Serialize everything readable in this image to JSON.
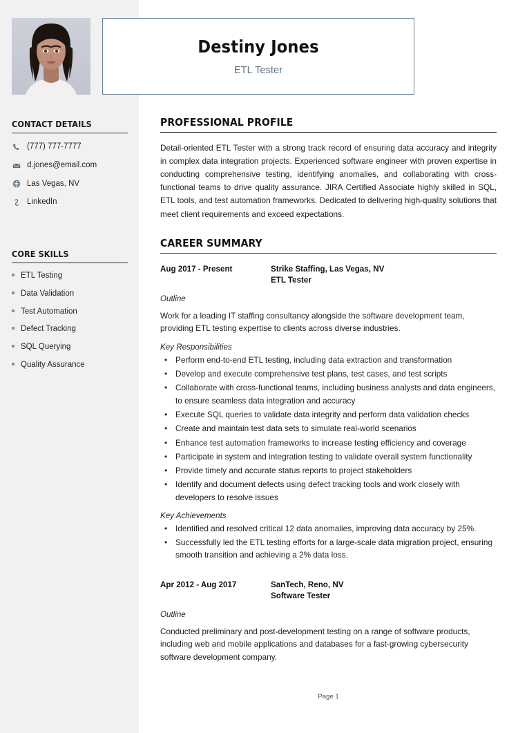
{
  "header": {
    "name": "Destiny Jones",
    "title": "ETL Tester",
    "photo_alt": "candidate-photo",
    "border_color": "#6b7f94",
    "title_color": "#5c7185"
  },
  "sidebar": {
    "background": "#f1f1f1",
    "contact": {
      "heading": "CONTACT DETAILS",
      "items": [
        {
          "icon": "phone-icon",
          "label": "(777) 777-7777"
        },
        {
          "icon": "envelope-icon",
          "label": "d.jones@email.com"
        },
        {
          "icon": "globe-icon",
          "label": "Las Vegas, NV"
        },
        {
          "icon": "link-icon",
          "label": "LinkedIn"
        }
      ]
    },
    "skills": {
      "heading": "CORE SKILLS",
      "items": [
        "ETL Testing",
        "Data Validation",
        "Test Automation",
        "Defect Tracking",
        "SQL Querying",
        "Quality Assurance"
      ]
    }
  },
  "main": {
    "profile": {
      "heading": "PROFESSIONAL PROFILE",
      "text": "Detail-oriented ETL Tester with a strong track record of ensuring data accuracy and integrity in complex data integration projects. Experienced software engineer with proven expertise in conducting comprehensive testing, identifying anomalies, and collaborating with cross-functional teams to drive quality assurance. JIRA Certified Associate highly skilled in SQL, ETL tools, and test automation frameworks. Dedicated to delivering high-quality solutions that meet client requirements and exceed expectations."
    },
    "career": {
      "heading": "CAREER SUMMARY",
      "jobs": [
        {
          "dates": "Aug 2017 - Present",
          "company": "Strike Staffing, Las Vegas, NV",
          "role": "ETL Tester",
          "outline_label": "Outline",
          "outline_text": "Work for a leading IT staffing consultancy alongside the software development team, providing ETL testing expertise to clients across diverse industries.",
          "responsibilities_label": "Key Responsibilities",
          "responsibilities": [
            "Perform end-to-end ETL testing, including data extraction and transformation",
            "Develop and execute comprehensive test plans, test cases, and test scripts",
            "Collaborate with cross-functional teams, including business analysts and data engineers, to ensure seamless data integration and accuracy",
            "Execute SQL queries to validate data integrity and perform data validation checks",
            "Create and maintain test data sets to simulate real-world scenarios",
            "Enhance test automation frameworks to increase testing efficiency and coverage",
            "Participate in system and integration testing to validate overall system functionality",
            "Provide timely and accurate status reports to project stakeholders",
            "Identify and document defects using defect tracking tools and work closely with developers to resolve issues"
          ],
          "achievements_label": "Key Achievements",
          "achievements": [
            "Identified and resolved critical 12 data anomalies, improving data accuracy by 25%.",
            "Successfully led the ETL testing efforts for a large-scale data migration project, ensuring smooth transition and achieving a 2% data loss."
          ]
        },
        {
          "dates": "Apr 2012 - Aug 2017",
          "company": "SanTech, Reno, NV",
          "role": "Software Tester",
          "outline_label": "Outline",
          "outline_text": "Conducted preliminary and post-development testing on a range of software products, including web and mobile applications and databases for a fast-growing cybersecurity software development company.",
          "responsibilities_label": "",
          "responsibilities": [],
          "achievements_label": "",
          "achievements": []
        }
      ]
    }
  },
  "footer": {
    "page_label": "Page 1"
  }
}
